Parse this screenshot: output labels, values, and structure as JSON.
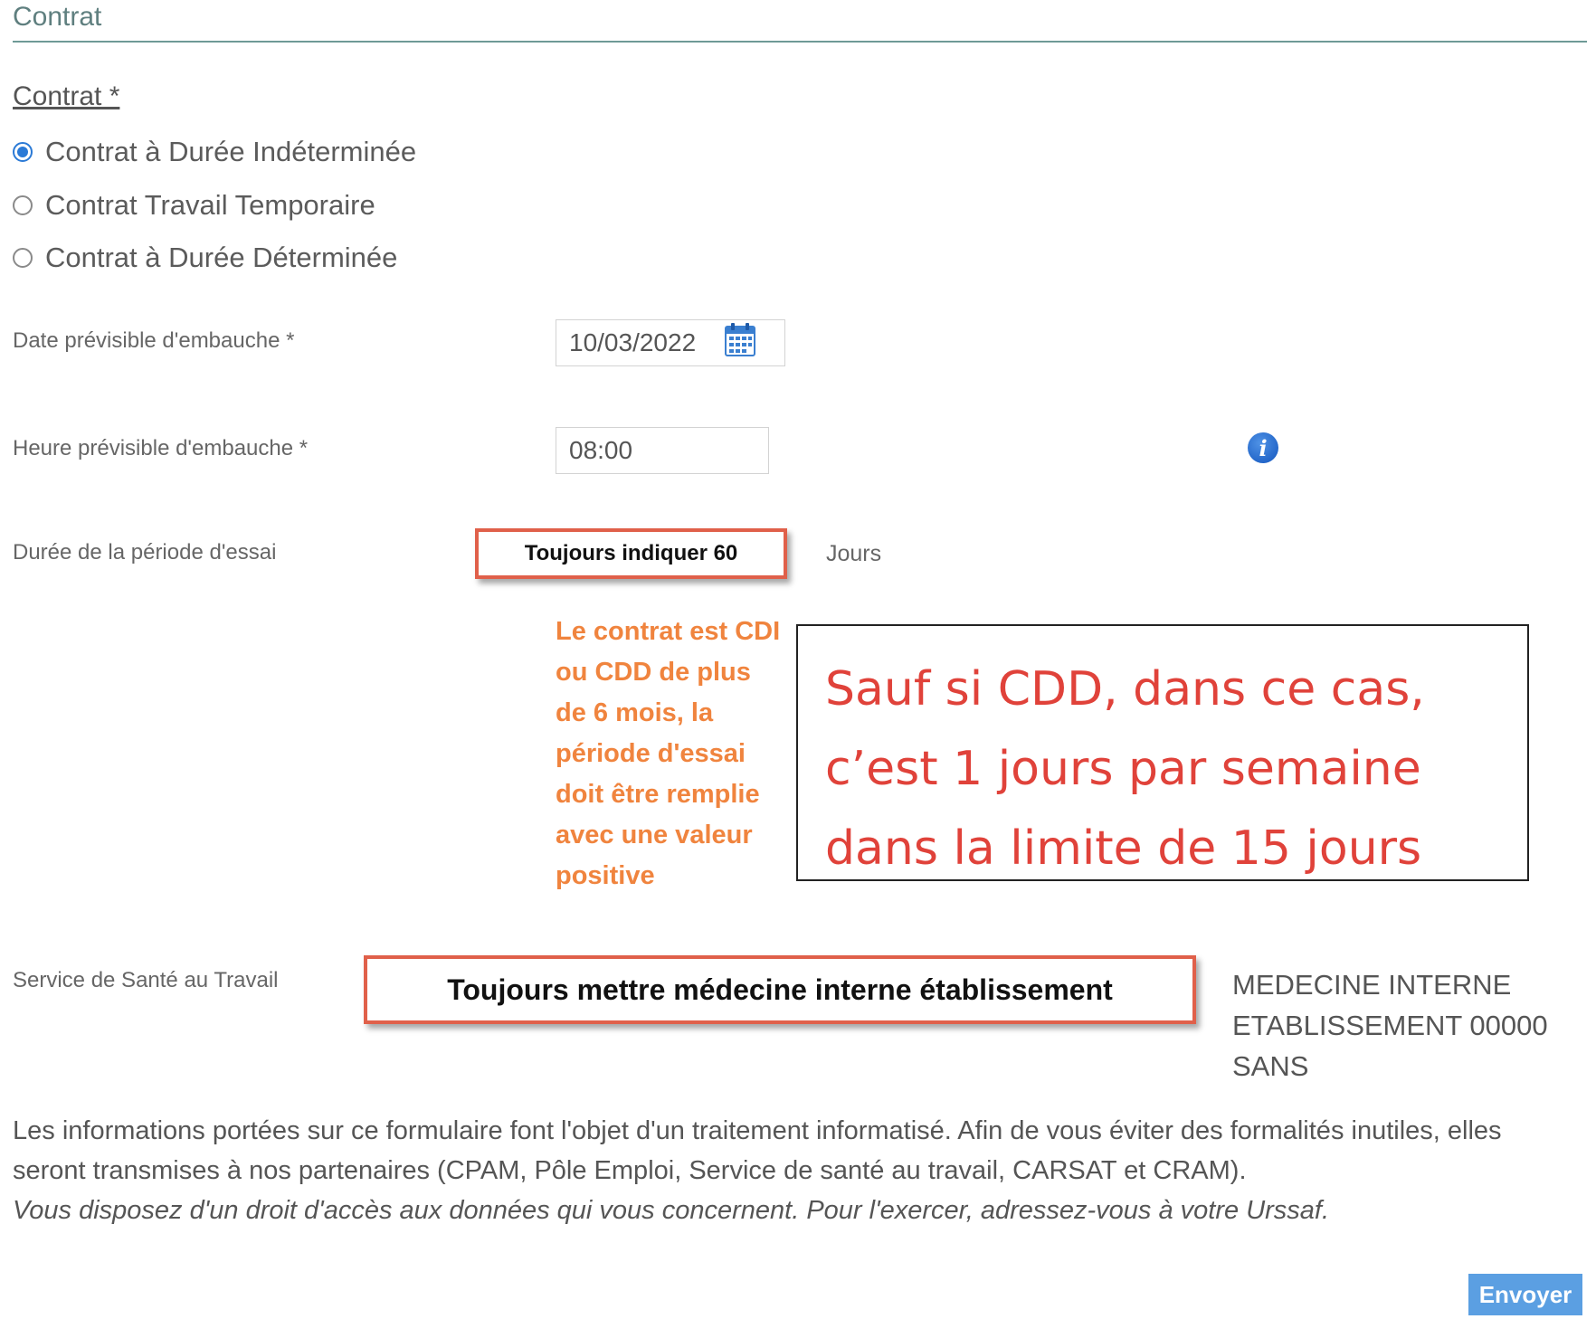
{
  "section": {
    "title": "Contrat"
  },
  "contract": {
    "label": "Contrat *",
    "options": [
      {
        "label": "Contrat à Durée Indéterminée",
        "selected": true
      },
      {
        "label": "Contrat Travail Temporaire",
        "selected": false
      },
      {
        "label": "Contrat à Durée Déterminée",
        "selected": false
      }
    ]
  },
  "hire_date": {
    "label": "Date prévisible d'embauche *",
    "value": "10/03/2022",
    "icon": "calendar-icon"
  },
  "hire_time": {
    "label": "Heure prévisible d'embauche *",
    "value": "08:00",
    "info_icon": "info-icon"
  },
  "trial_period": {
    "label": "Durée de la période d'essai",
    "annotation": "Toujours indiquer 60",
    "unit": "Jours",
    "orange_note": "Le contrat est CDI ou CDD de plus de 6 mois, la période d'essai doit être remplie avec une valeur positive",
    "red_note_lines": [
      "Sauf si CDD, dans ce cas,",
      "c’est 1 jours par semaine",
      "dans la limite de 15 jours"
    ]
  },
  "health_service": {
    "label": "Service de Santé au Travail",
    "annotation": "Toujours mettre médecine interne établissement",
    "value_lines": [
      "MEDECINE INTERNE",
      "ETABLISSEMENT 00000",
      "SANS"
    ]
  },
  "footer": {
    "info": "Les informations portées sur ce formulaire font l'objet d'un traitement informatisé. Afin de vous éviter des formalités inutiles, elles seront transmises à nos partenaires (CPAM, Pôle Emploi, Service de santé au travail, CARSAT et CRAM).",
    "rights": "Vous disposez d'un droit d'accès aux données qui vous concernent. Pour l'exercer, adressez-vous à votre Urssaf."
  },
  "submit": {
    "label": "Envoyer"
  },
  "colors": {
    "accent_blue": "#2b7ad6",
    "annotation_red": "#e0604a",
    "note_orange": "#f0843e",
    "note_red_text": "#e0423a",
    "button_blue": "#5b9fe2"
  }
}
